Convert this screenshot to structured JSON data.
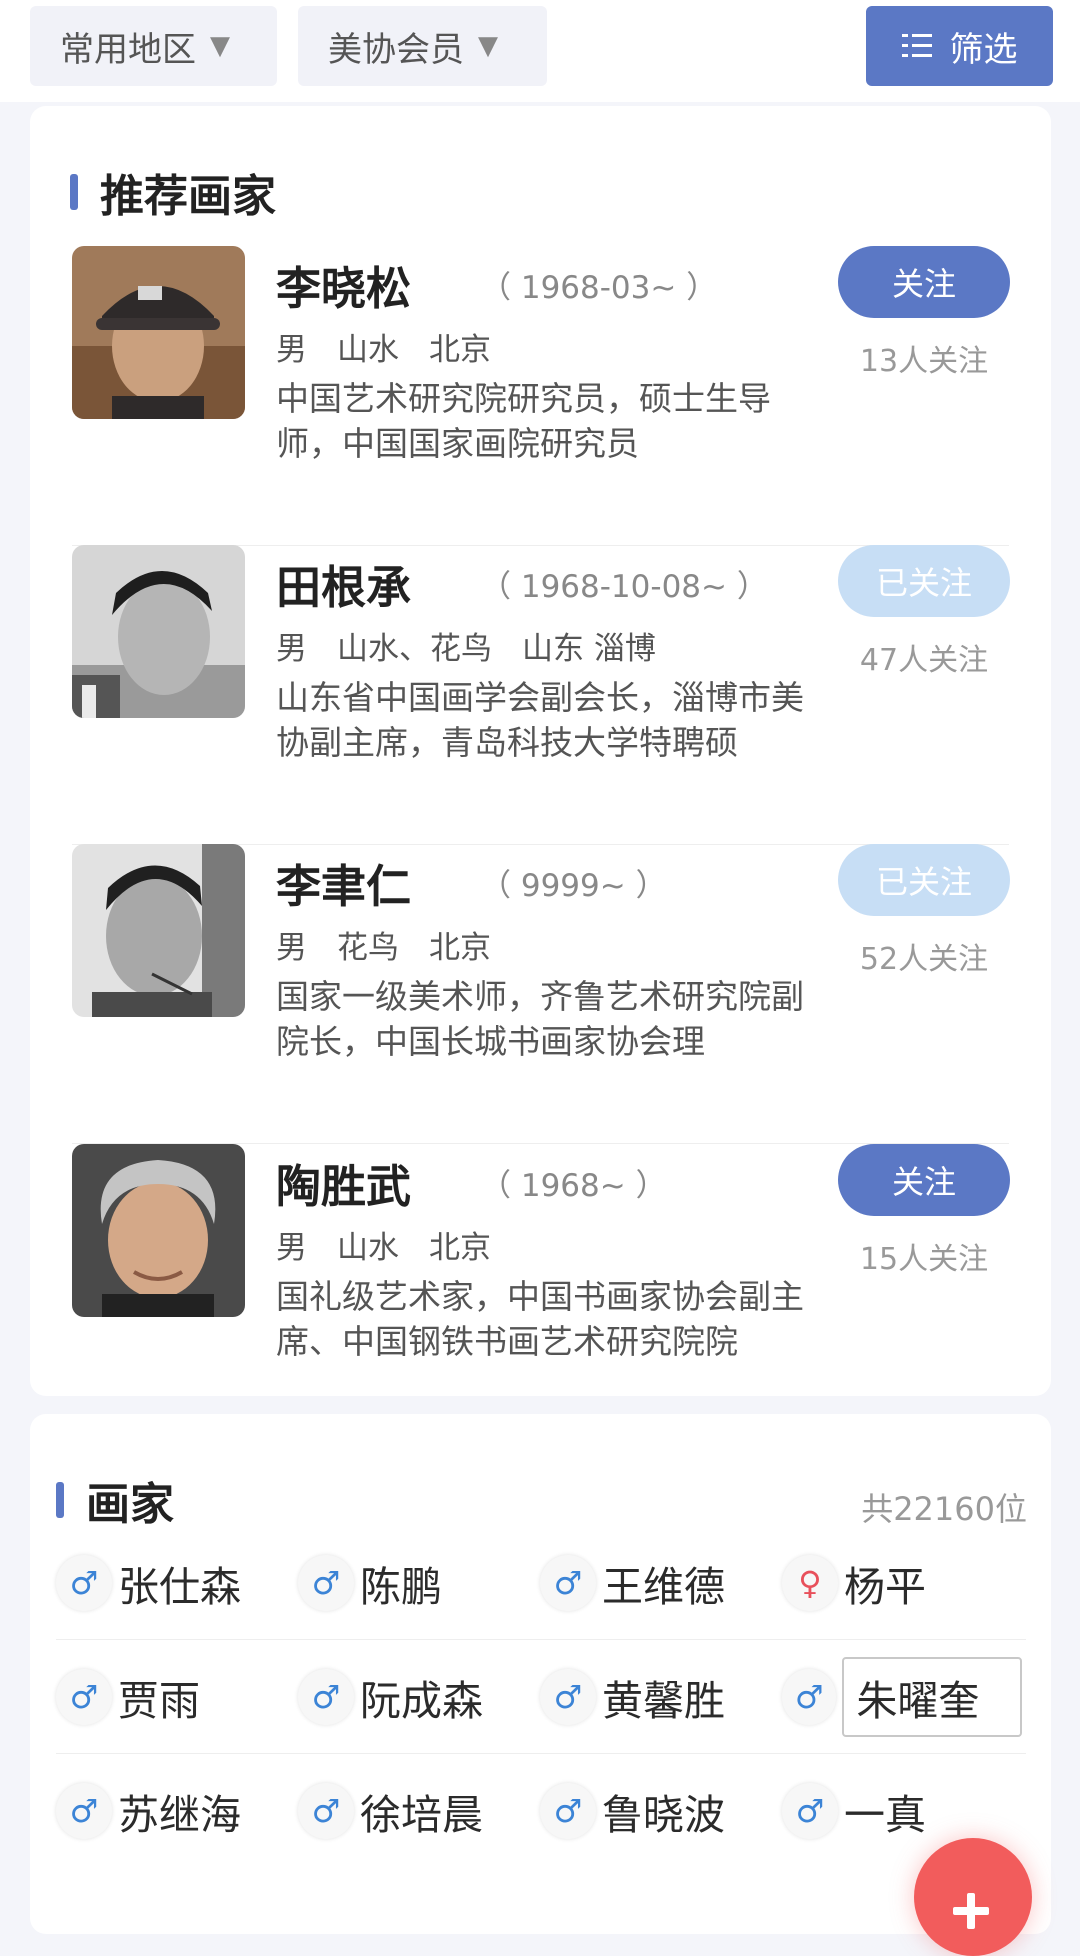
{
  "filters": {
    "region_label": "常用地区",
    "member_label": "美协会员",
    "filter_button": "筛选"
  },
  "recommended": {
    "title": "推荐画家",
    "artists": [
      {
        "name": "李晓松",
        "dates": "（ 1968-03~ ）",
        "gender": "男",
        "genre": "山水",
        "location": "北京",
        "bio": "中国艺术研究院研究员，硕士生导师，中国国家画院研究员",
        "follow_label": "关注",
        "followed": false,
        "follow_count": "13人关注"
      },
      {
        "name": "田根承",
        "dates": "（ 1968-10-08~ ）",
        "gender": "男",
        "genre": "山水、花鸟",
        "location": "山东 淄博",
        "bio": "山东省中国画学会副会长，淄博市美协副主席，青岛科技大学特聘硕",
        "follow_label": "已关注",
        "followed": true,
        "follow_count": "47人关注"
      },
      {
        "name": "李聿仁",
        "dates": "（ 9999~ ）",
        "gender": "男",
        "genre": "花鸟",
        "location": "北京",
        "bio": "国家一级美术师，齐鲁艺术研究院副院长，中国长城书画家协会理",
        "follow_label": "已关注",
        "followed": true,
        "follow_count": "52人关注"
      },
      {
        "name": "陶胜武",
        "dates": "（ 1968~ ）",
        "gender": "男",
        "genre": "山水",
        "location": "北京",
        "bio": "国礼级艺术家，中国书画家协会副主席、中国钢铁书画艺术研究院院",
        "follow_label": "关注",
        "followed": false,
        "follow_count": "15人关注"
      }
    ]
  },
  "painters": {
    "title": "画家",
    "total": "共22160位",
    "male_symbol": "♂",
    "female_symbol": "♀",
    "rows": [
      [
        {
          "name": "张仕森",
          "gender": "male"
        },
        {
          "name": "陈鹏",
          "gender": "male"
        },
        {
          "name": "王维德",
          "gender": "male"
        },
        {
          "name": "杨平",
          "gender": "female"
        }
      ],
      [
        {
          "name": "贾雨",
          "gender": "male"
        },
        {
          "name": "阮成森",
          "gender": "male"
        },
        {
          "name": "黄馨胜",
          "gender": "male"
        },
        {
          "name": "朱曜奎",
          "gender": "male",
          "boxed": true
        }
      ],
      [
        {
          "name": "苏继海",
          "gender": "male"
        },
        {
          "name": "徐培晨",
          "gender": "male"
        },
        {
          "name": "鲁晓波",
          "gender": "male"
        },
        {
          "name": "一真",
          "gender": "male"
        }
      ]
    ]
  },
  "colors": {
    "accent": "#5b78c5",
    "followed": "#c7def5",
    "male": "#3c84d6",
    "female": "#e8505b",
    "fab": "#f25c5c"
  }
}
